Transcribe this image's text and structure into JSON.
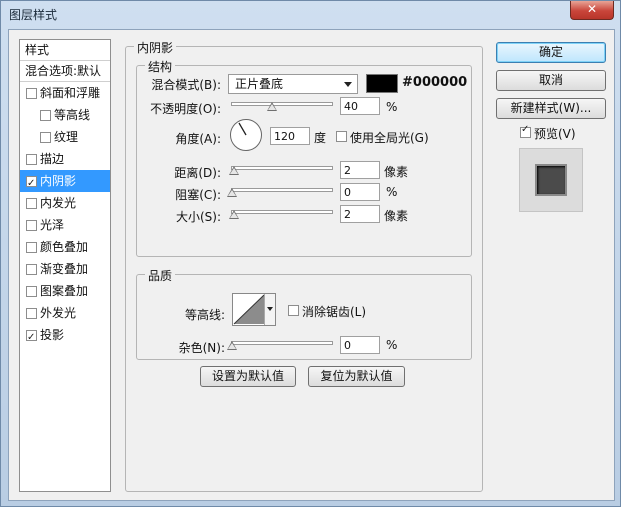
{
  "window": {
    "title": "图层样式",
    "close": "✕"
  },
  "styles_list": {
    "header": "样式",
    "blend": "混合选项:默认",
    "items": [
      {
        "label": "斜面和浮雕",
        "checked": false,
        "indent": false,
        "selected": false
      },
      {
        "label": "等高线",
        "checked": false,
        "indent": true,
        "selected": false
      },
      {
        "label": "纹理",
        "checked": false,
        "indent": true,
        "selected": false
      },
      {
        "label": "描边",
        "checked": false,
        "indent": false,
        "selected": false
      },
      {
        "label": "内阴影",
        "checked": true,
        "indent": false,
        "selected": true
      },
      {
        "label": "内发光",
        "checked": false,
        "indent": false,
        "selected": false
      },
      {
        "label": "光泽",
        "checked": false,
        "indent": false,
        "selected": false
      },
      {
        "label": "颜色叠加",
        "checked": false,
        "indent": false,
        "selected": false
      },
      {
        "label": "渐变叠加",
        "checked": false,
        "indent": false,
        "selected": false
      },
      {
        "label": "图案叠加",
        "checked": false,
        "indent": false,
        "selected": false
      },
      {
        "label": "外发光",
        "checked": false,
        "indent": false,
        "selected": false
      },
      {
        "label": "投影",
        "checked": true,
        "indent": false,
        "selected": false
      }
    ]
  },
  "inner_shadow": {
    "title": "内阴影",
    "structure": {
      "title": "结构",
      "blend_mode_label": "混合模式(B):",
      "blend_mode": "正片叠底",
      "color_hex": "#000000",
      "color_value": "#000000",
      "opacity_label": "不透明度(O):",
      "opacity": "40",
      "opacity_fraction": 0.4,
      "percent": "%",
      "angle_label": "角度(A):",
      "angle": "120",
      "angle_unit": "度",
      "global_light_label": "使用全局光(G)",
      "global_light": false,
      "distance_label": "距离(D):",
      "distance": "2",
      "distance_fraction": 0.02,
      "choke_label": "阻塞(C):",
      "choke": "0",
      "choke_fraction": 0,
      "size_label": "大小(S):",
      "size": "2",
      "size_fraction": 0.02,
      "pixels": "像素"
    },
    "quality": {
      "title": "品质",
      "contour_label": "等高线:",
      "anti_alias_label": "消除锯齿(L)",
      "anti_alias": false,
      "noise_label": "杂色(N):",
      "noise": "0",
      "noise_fraction": 0
    },
    "make_default": "设置为默认值",
    "reset_default": "复位为默认值"
  },
  "buttons": {
    "ok": "确定",
    "cancel": "取消",
    "new_style": "新建样式(W)...",
    "preview_label": "预览(V)",
    "preview": true
  }
}
